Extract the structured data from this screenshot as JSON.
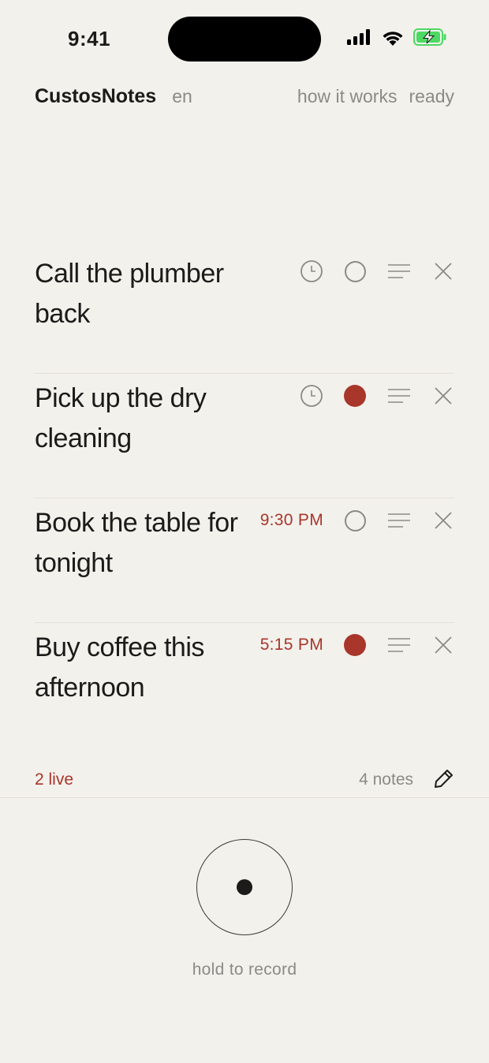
{
  "status_bar": {
    "time": "9:41",
    "icons": [
      "signal-icon",
      "wifi-icon",
      "battery-charging-icon"
    ]
  },
  "header": {
    "app_title": "CustosNotes",
    "language": "en",
    "how_link": "how it works",
    "status": "ready"
  },
  "notes": [
    {
      "text": "Call the plumber back",
      "time": "",
      "live": false
    },
    {
      "text": "Pick up the dry cleaning",
      "time": "",
      "live": true
    },
    {
      "text": "Book the table for tonight",
      "time": "9:30 PM",
      "live": false
    },
    {
      "text": "Buy coffee this afternoon",
      "time": "5:15 PM",
      "live": true
    }
  ],
  "footer": {
    "live_count": "2 live",
    "notes_count": "4 notes"
  },
  "record": {
    "label": "hold to record"
  },
  "colors": {
    "background": "#f3f1ec",
    "accent": "#a8362b",
    "muted": "#8c8a86",
    "text": "#1c1b19"
  }
}
